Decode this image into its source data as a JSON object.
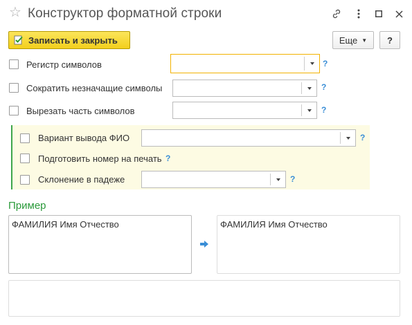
{
  "window": {
    "title": "Конструктор форматной строки"
  },
  "toolbar": {
    "save_close_label": "Записать и закрыть",
    "more_label": "Еще",
    "help_label": "?"
  },
  "fields": {
    "register": {
      "label": "Регистр символов",
      "value": ""
    },
    "trim": {
      "label": "Сократить незначащие символы",
      "value": ""
    },
    "cut": {
      "label": "Вырезать часть символов",
      "value": ""
    },
    "fio": {
      "label": "Вариант вывода ФИО",
      "value": ""
    },
    "print": {
      "label": "Подготовить номер на печать"
    },
    "case": {
      "label": "Склонение в падеже",
      "value": ""
    }
  },
  "help_mark": "?",
  "example": {
    "title": "Пример",
    "input": "ФАМИЛИЯ Имя Отчество",
    "output": "ФАМИЛИЯ Имя Отчество",
    "result_string": ""
  },
  "colors": {
    "accent_yellow": "#f3cf1c",
    "group_border": "#3fa64b",
    "help_blue": "#3a8ed6",
    "section_green": "#2a9a3a"
  }
}
